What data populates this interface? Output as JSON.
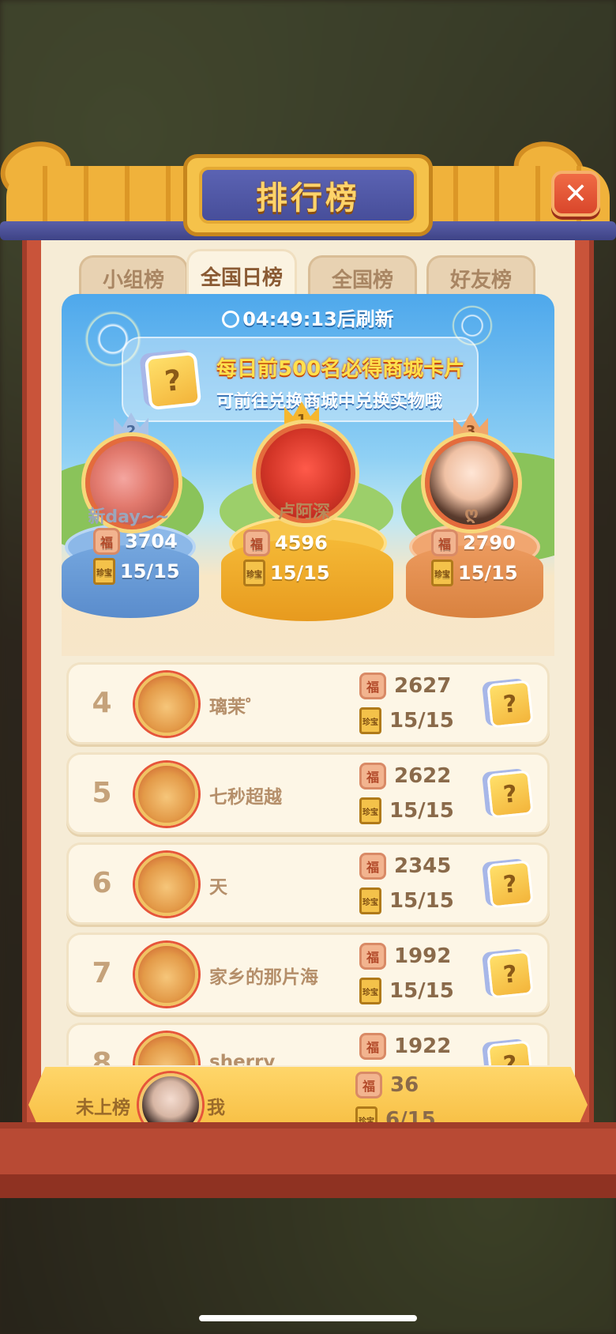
{
  "header": {
    "title": "排行榜",
    "close_symbol": "✕"
  },
  "tabs": [
    {
      "label": "小组榜",
      "active": false
    },
    {
      "label": "全国日榜",
      "active": true
    },
    {
      "label": "全国榜",
      "active": false
    },
    {
      "label": "好友榜",
      "active": false
    }
  ],
  "refresh": {
    "text": "04:49:13后刷新"
  },
  "promo": {
    "line1": "每日前500名必得商城卡片",
    "line2": "可前往兑换商城中兑换实物哦",
    "card_symbol": "?"
  },
  "podium": [
    {
      "rank": "2",
      "name": "新day~~",
      "score": "3704",
      "progress": "15/15"
    },
    {
      "rank": "1",
      "name": "卢阿深",
      "score": "4596",
      "progress": "15/15"
    },
    {
      "rank": "3",
      "name": "ღ",
      "score": "2790",
      "progress": "15/15"
    }
  ],
  "list": [
    {
      "rank": "4",
      "name": "璃茉゜",
      "score": "2627",
      "progress": "15/15",
      "card": "?"
    },
    {
      "rank": "5",
      "name": "七秒超越",
      "score": "2622",
      "progress": "15/15",
      "card": "?"
    },
    {
      "rank": "6",
      "name": "天",
      "score": "2345",
      "progress": "15/15",
      "card": "?"
    },
    {
      "rank": "7",
      "name": "家乡的那片海",
      "score": "1992",
      "progress": "15/15",
      "card": "?"
    },
    {
      "rank": "8",
      "name": "sherry",
      "score": "1922",
      "progress": "",
      "card": "?"
    }
  ],
  "me": {
    "rank_label": "未上榜",
    "name": "我",
    "score": "36",
    "progress": "6/15"
  },
  "icons": {
    "fu": "福",
    "book": "珍宝"
  },
  "colors": {
    "accent_gold": "#f6b72f",
    "title_blue": "#474e9a",
    "frame_red": "#c9543a"
  }
}
